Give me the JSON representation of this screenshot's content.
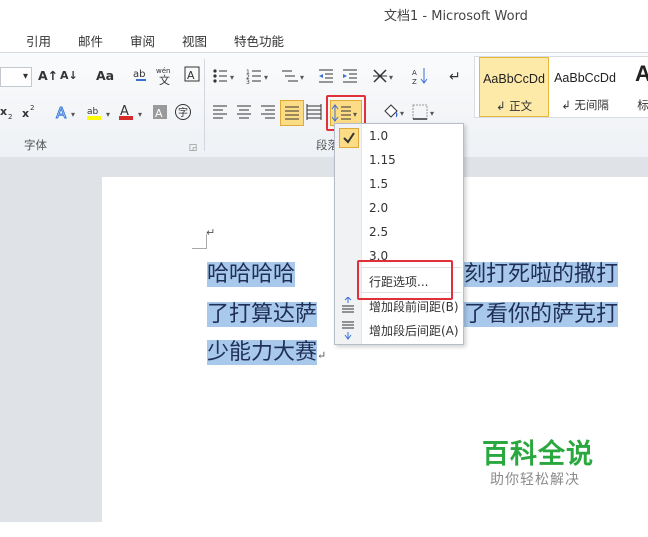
{
  "window": {
    "title": "文档1  -  Microsoft Word"
  },
  "tabs": [
    "引用",
    "邮件",
    "审阅",
    "视图",
    "特色功能"
  ],
  "ribbon": {
    "font_group_label": "字体",
    "paragraph_group_label": "段落",
    "styles": [
      {
        "preview": "AaBbCcDd",
        "name": "↲ 正文",
        "selected": true
      },
      {
        "preview": "AaBbCcDd",
        "name": "↲ 无间隔",
        "selected": false
      },
      {
        "preview": "A",
        "name": "标",
        "selected": false
      }
    ],
    "font_icons_row1": [
      "A↑",
      "A↓",
      "Aa"
    ],
    "accent_colors": {
      "highlight": "#ffff00",
      "font_color": "#d62b2b",
      "selected_style": "#fde9a8",
      "red_box": "#e0303a",
      "selection": "#a9c9ec"
    }
  },
  "line_spacing_menu": {
    "items": [
      "1.0",
      "1.15",
      "1.5",
      "2.0",
      "2.5",
      "3.0"
    ],
    "checked": "1.0",
    "options": "行距选项...",
    "add_before": "增加段前间距(B)",
    "add_after": "增加段后间距(A)"
  },
  "document": {
    "lines": [
      {
        "left": "哈哈哈哈",
        "right": "刻打死啦的撒打"
      },
      {
        "left": "了打算达萨",
        "right": "了看你的萨克打"
      },
      {
        "left": "少能力大赛",
        "right": ""
      }
    ],
    "paragraph_mark": "↵"
  },
  "watermark": {
    "title": "百科全说",
    "subtitle": "助你轻松解决"
  }
}
